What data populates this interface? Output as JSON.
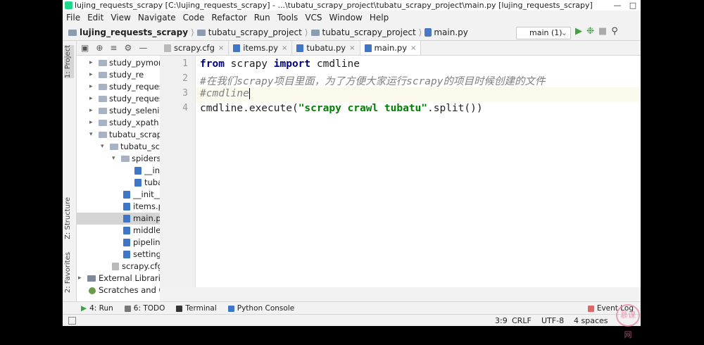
{
  "title": "lujing_requests_scrapy [C:\\lujing_requests_scrapy] - ...\\tubatu_scrapy_project\\tubatu_scrapy_project\\main.py [lujing_requests_scrapy] - PyCharm (Administrat...",
  "menu": [
    "File",
    "Edit",
    "View",
    "Navigate",
    "Code",
    "Refactor",
    "Run",
    "Tools",
    "VCS",
    "Window",
    "Help"
  ],
  "breadcrumb": [
    "lujing_requests_scrapy",
    "tubatu_scrapy_project",
    "tubatu_scrapy_project",
    "main.py"
  ],
  "run_config": "main (1)",
  "left_strip": {
    "project": "1: Project",
    "structure": "Z: Structure",
    "favorites": "2: Favorites"
  },
  "tree": [
    "study_pymong",
    "study_re",
    "study_request",
    "study_requests",
    "study_seleniun",
    "study_xpath",
    "tubatu_scrapy",
    "tubatu_scra",
    "spiders",
    "__ini",
    "tuba",
    "__init__.",
    "items.py",
    "main.py",
    "middlev",
    "pipeline",
    "settings",
    "scrapy.cfg",
    "External Libraries",
    "Scratches and Co"
  ],
  "tabs": [
    "scrapy.cfg",
    "items.py",
    "tubatu.py",
    "main.py"
  ],
  "line_numbers": [
    "1",
    "2",
    "3",
    "4"
  ],
  "code": {
    "l1_kw1": "from",
    "l1_mid": " scrapy ",
    "l1_kw2": "import",
    "l1_end": " cmdline",
    "l2": "#在我们scrapy项目里面，为了方便大家运行scrapy的项目时候创建的文件",
    "l3": "#cmdline",
    "l4_start": "cmdline.execute(",
    "l4_str": "\"scrapy crawl tubatu\"",
    "l4_end": ".split())"
  },
  "bottom_tools": [
    "4: Run",
    "6: TODO",
    "Terminal",
    "Python Console"
  ],
  "event_log": "Event Log",
  "status": {
    "position": "3:9",
    "line_sep": "CRLF",
    "encoding": "UTF-8",
    "indent": "4 spaces"
  },
  "watermark": "慕课网"
}
